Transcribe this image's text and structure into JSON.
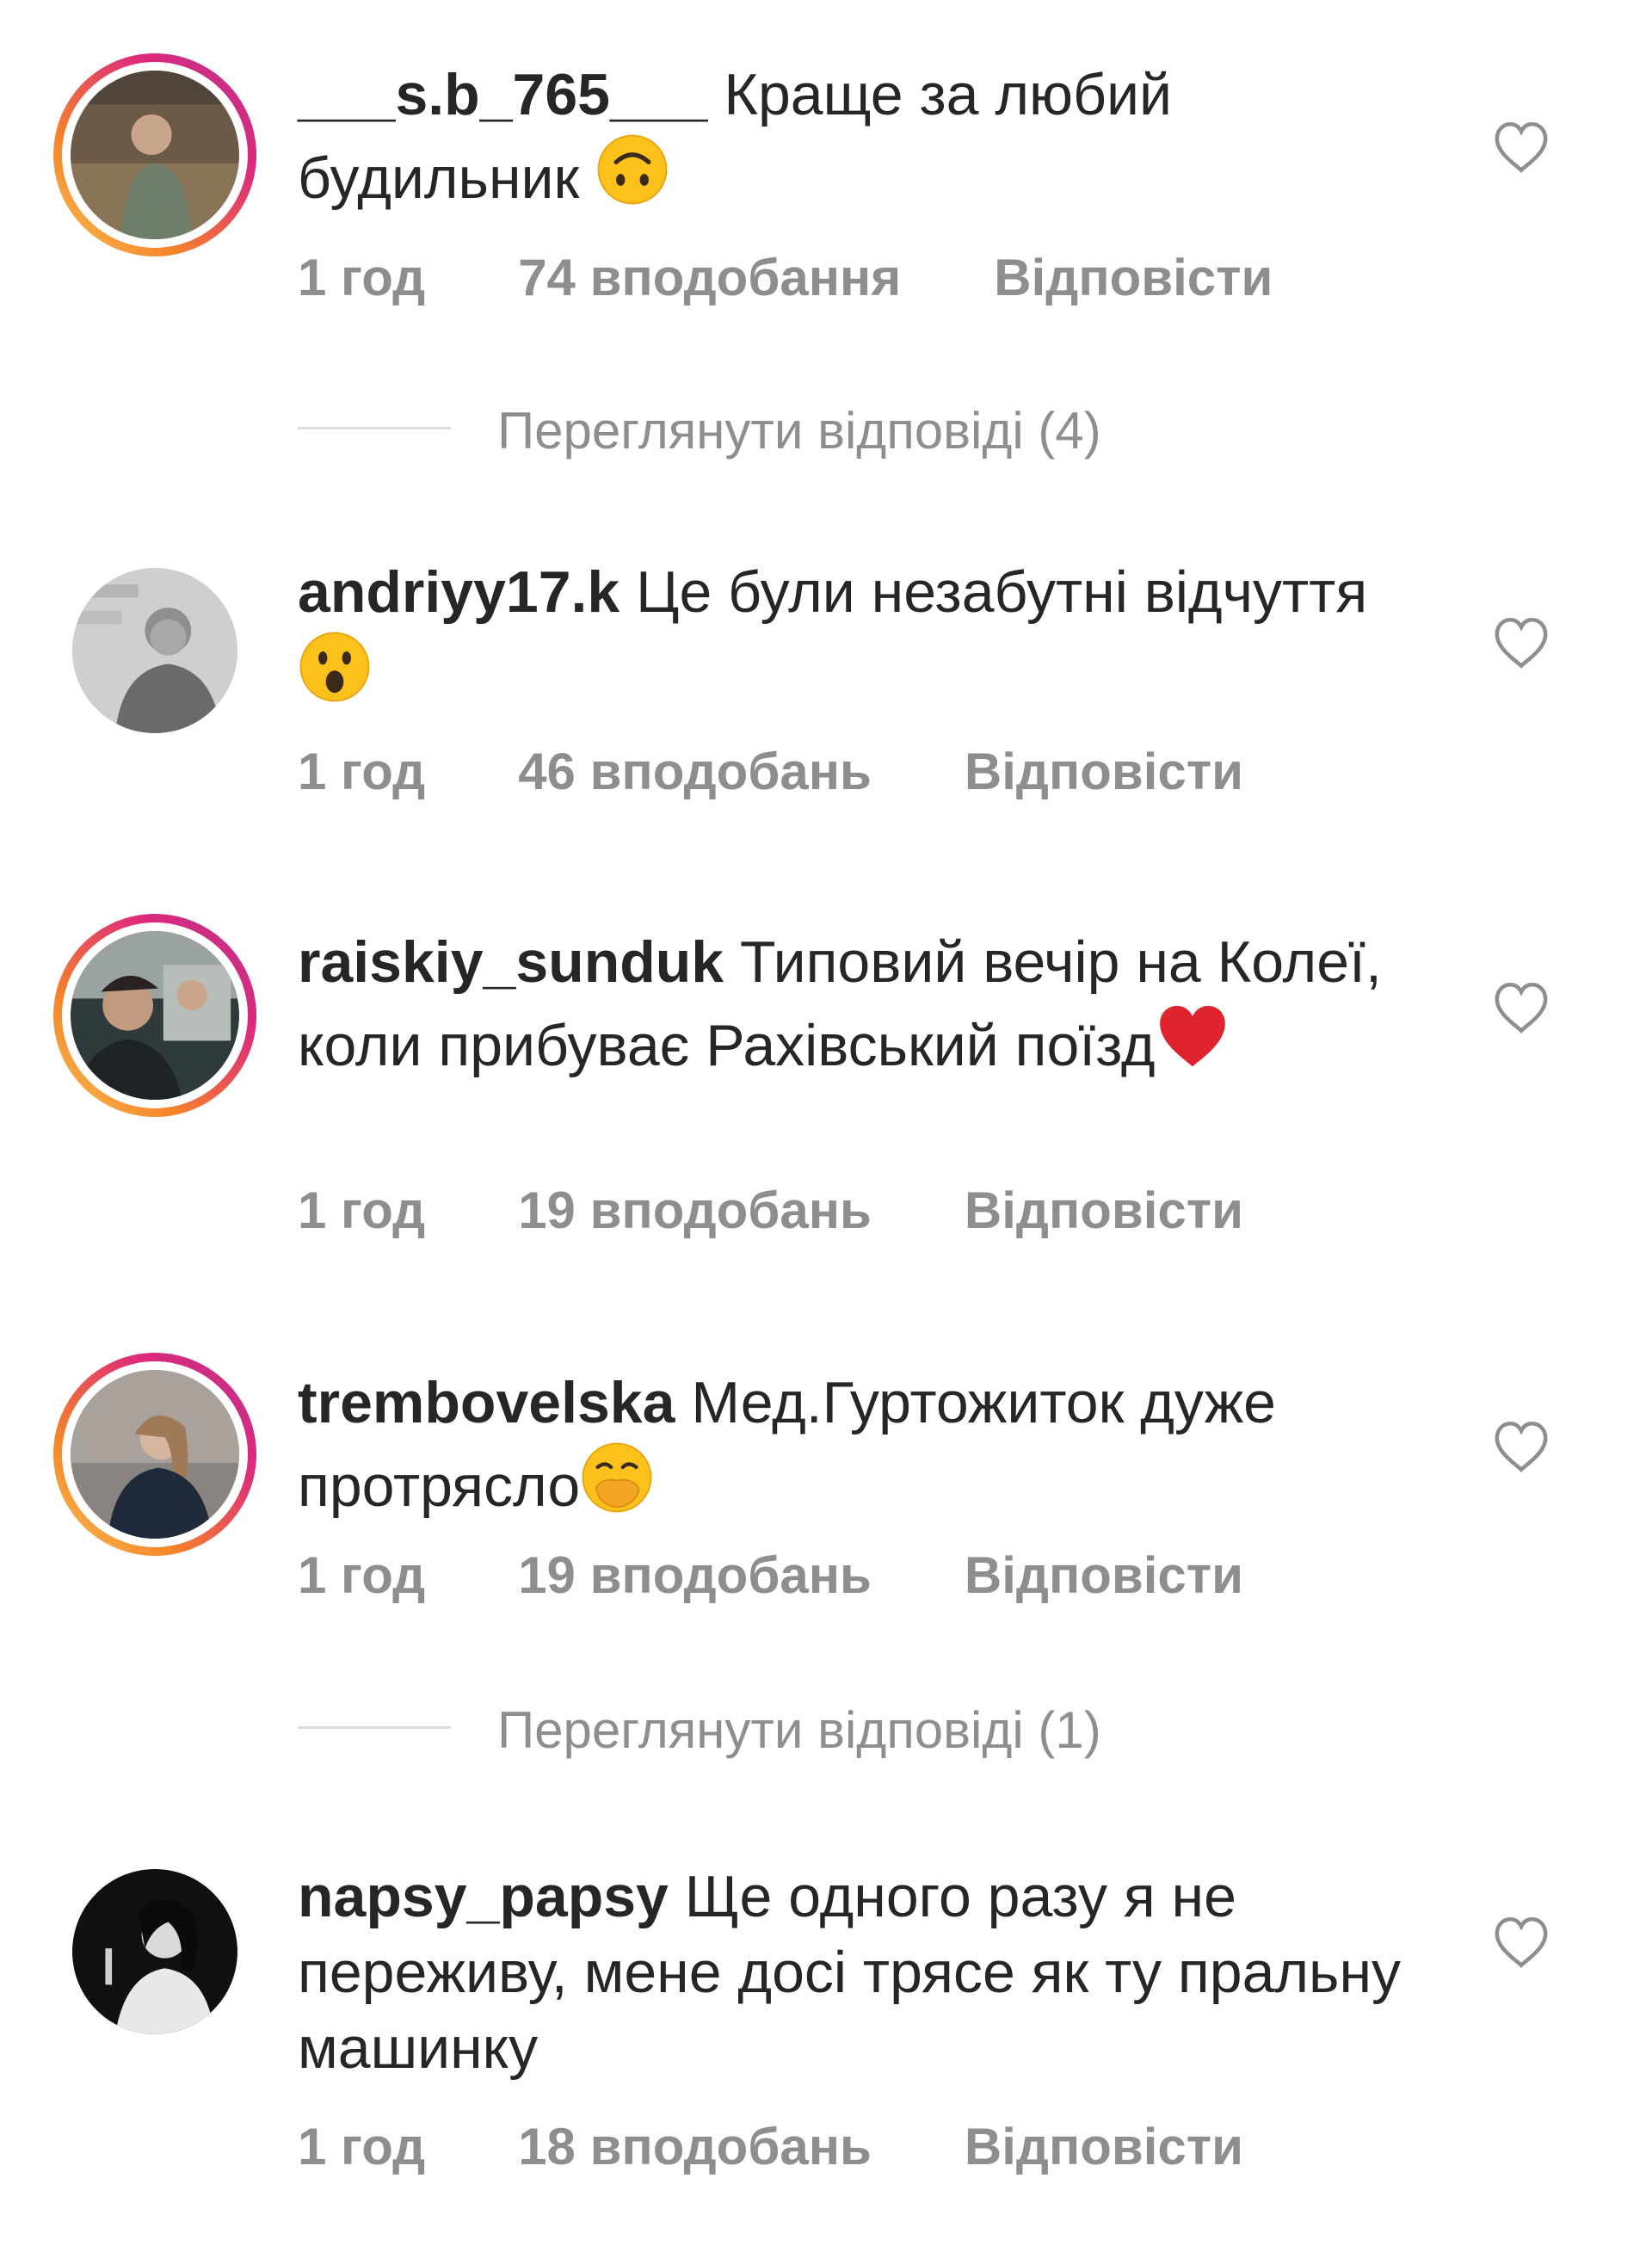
{
  "comments": [
    {
      "username": "___s.b_765___",
      "text": "Краще за любий будильник",
      "emoji": "upside-down-face",
      "time": "1 год",
      "likes": "74 вподобання",
      "reply": "Відповісти",
      "has_story_ring": true
    },
    {
      "username": "andriyy17.k",
      "text": "Це були незабутні відчуття",
      "emoji": "astonished-face",
      "time": "1 год",
      "likes": "46 вподобань",
      "reply": "Відповісти",
      "has_story_ring": false
    },
    {
      "username": "raiskiy_sunduk",
      "text": "Типовий вечір на Колеї, коли прибуває Рахівський поїзд",
      "emoji": "red-heart",
      "time": "1 год",
      "likes": "19 вподобань",
      "reply": "Відповісти",
      "has_story_ring": true
    },
    {
      "username": "trembovelska",
      "text": "Мед.Гуртожиток дуже протрясло",
      "emoji": "face-with-hand-over-mouth",
      "time": "1 год",
      "likes": "19 вподобань",
      "reply": "Відповісти",
      "has_story_ring": true
    },
    {
      "username": "napsy_papsy",
      "text": "Ще одного разу я не переживу, мене досі трясе як ту пральну машинку",
      "emoji": "",
      "time": "1 год",
      "likes": "18 вподобань",
      "reply": "Відповісти",
      "has_story_ring": false
    }
  ],
  "view_replies": [
    {
      "label": "Переглянути відповіді (4)"
    },
    {
      "label": "Переглянути відповіді (1)"
    }
  ],
  "colors": {
    "text": "#262626",
    "secondary": "#8e8e8e",
    "divider": "#dbdbdb",
    "ring_start": "#f9c45a",
    "ring_end": "#b8328f"
  }
}
